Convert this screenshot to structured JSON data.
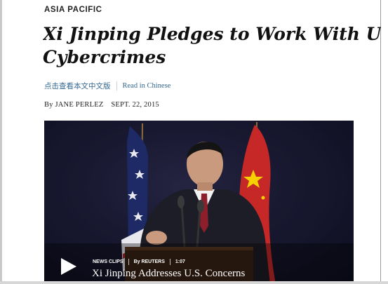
{
  "article": {
    "section": "ASIA PACIFIC",
    "headline_line1": "Xi Jinping Pledges to Work With U.S. t",
    "headline_line2": "Cybercrimes",
    "chinese_link": "点击查看本文中文版",
    "english_link": "Read in Chinese",
    "byline_prefix": "By",
    "author": "JANE PERLEZ",
    "date": "SEPT. 22, 2015"
  },
  "video": {
    "series": "NEWS CLIPS",
    "source": "By REUTERS",
    "duration": "1:07",
    "title": "Xi Jinping Addresses U.S. Concerns",
    "play_icon": "play-icon"
  },
  "colors": {
    "link": "#326891",
    "text": "#111111",
    "flag_red": "#c62828",
    "flag_star": "#f6d000"
  }
}
